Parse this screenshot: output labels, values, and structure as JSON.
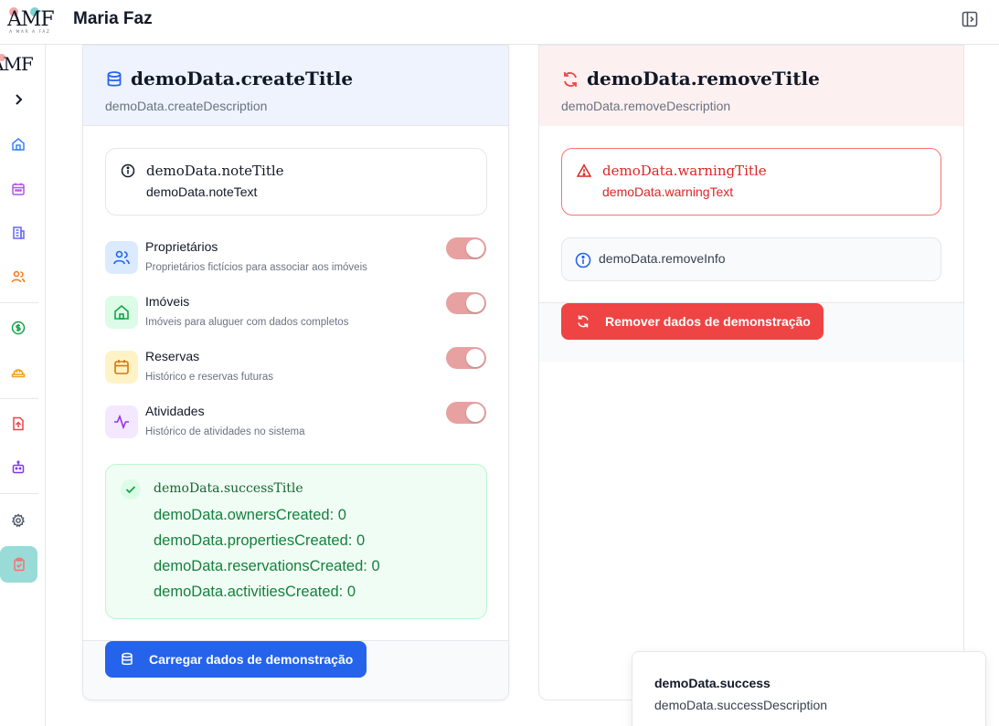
{
  "app": {
    "logo_text": "AMF",
    "logo_subtext": "A MAR A FAZ",
    "title": "Maria Faz"
  },
  "sidebar": {
    "items": [
      {
        "icon": "home-icon",
        "color": "#3b82f6"
      },
      {
        "icon": "calendar-icon",
        "color": "#a855f7"
      },
      {
        "icon": "building-icon",
        "color": "#6366f1"
      },
      {
        "icon": "users-icon",
        "color": "#f97316"
      },
      {
        "icon": "dollar-icon",
        "color": "#16a34a"
      },
      {
        "icon": "hardhat-icon",
        "color": "#f59e0b"
      },
      {
        "icon": "file-upload-icon",
        "color": "#ef4444"
      },
      {
        "icon": "bot-icon",
        "color": "#7c3aed"
      },
      {
        "icon": "gear-icon",
        "color": "#4b5563"
      },
      {
        "icon": "clipboard-icon",
        "color": "#f87171"
      }
    ]
  },
  "create_card": {
    "title": "demoData.createTitle",
    "description": "demoData.createDescription",
    "note_title": "demoData.noteTitle",
    "note_text": "demoData.noteText",
    "options": [
      {
        "label": "Proprietários",
        "desc": "Proprietários fictícios para associar aos imóveis",
        "icon": "users-icon",
        "bg": "#dbeafe",
        "color": "#2563eb",
        "enabled": true
      },
      {
        "label": "Imóveis",
        "desc": "Imóveis para aluguer com dados completos",
        "icon": "home-icon",
        "bg": "#dcfce7",
        "color": "#16a34a",
        "enabled": true
      },
      {
        "label": "Reservas",
        "desc": "Histórico e reservas futuras",
        "icon": "calendar-icon",
        "bg": "#fef3c7",
        "color": "#d97706",
        "enabled": true
      },
      {
        "label": "Atividades",
        "desc": "Histórico de atividades no sistema",
        "icon": "activity-icon",
        "bg": "#f3e8ff",
        "color": "#9333ea",
        "enabled": true
      }
    ],
    "success_title": "demoData.successTitle",
    "success_lines": [
      "demoData.ownersCreated: 0",
      "demoData.propertiesCreated: 0",
      "demoData.reservationsCreated: 0",
      "demoData.activitiesCreated: 0"
    ],
    "button_label": "Carregar dados de demonstração"
  },
  "remove_card": {
    "title": "demoData.removeTitle",
    "description": "demoData.removeDescription",
    "warning_title": "demoData.warningTitle",
    "warning_text": "demoData.warningText",
    "info_text": "demoData.removeInfo",
    "button_label": "Remover dados de demonstração"
  },
  "toast": {
    "title": "demoData.success",
    "description": "demoData.successDescription"
  },
  "colors": {
    "accent_blue": "#2563eb",
    "danger_red": "#ef4444",
    "success_green": "#15803d",
    "toggle_on": "#e8a1a1",
    "sidebar_active": "#99dcd7"
  }
}
